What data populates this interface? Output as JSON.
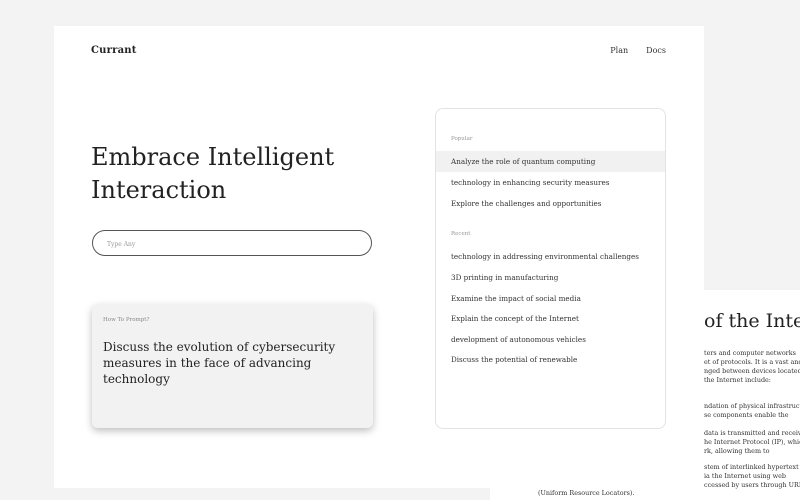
{
  "app": {
    "logo": "Currant",
    "nav": [
      "Plan",
      "Docs"
    ]
  },
  "hero": {
    "title_line1": "Embrace Intelligent",
    "title_line2": "Interaction"
  },
  "search": {
    "placeholder": "Type Any",
    "value": ""
  },
  "prompt_card": {
    "label": "How To Prompt?",
    "text": "Discuss the evolution of cybersecurity measures in the face of advancing technology"
  },
  "suggestions": {
    "popular_label": "Popular",
    "popular": [
      "Analyze the role of quantum computing",
      "technology in enhancing security measures",
      "Explore the challenges and opportunities"
    ],
    "recent_label": "Recent",
    "recent": [
      "technology in addressing environmental challenges",
      "3D printing in manufacturing",
      "Examine the impact of social media",
      "Explain the concept of the Internet",
      "development of autonomous vehicles",
      "Discuss the potential of renewable"
    ]
  },
  "background_doc": {
    "title": "of the Inter",
    "lines": [
      "ters and computer networks",
      "et of protocols. It is a vast and",
      "nged between devices located",
      "the Internet include:",
      "ndation of physical infrastruct",
      "se components enable the",
      "data is transmitted and receiv",
      "he Internet Protocol (IP), which",
      "rk, allowing them to",
      "stem of interlinked hypertext",
      "ia the Internet using web",
      "ccessed by users through URL",
      "(Uniform Resource Locators)."
    ]
  }
}
